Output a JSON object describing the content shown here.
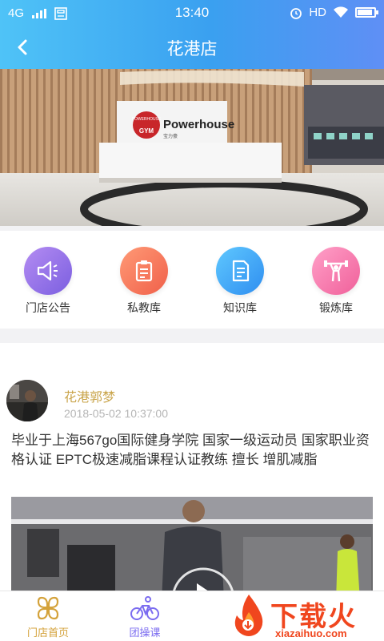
{
  "status_bar": {
    "network": "4G",
    "time": "13:40",
    "hd": "HD"
  },
  "header": {
    "title": "花港店"
  },
  "hero": {
    "sign_brand": "Powerhouse",
    "sign_gym_top": "POWERHOUSE",
    "sign_gym_bottom": "GYM",
    "sign_cn": "宝力豪"
  },
  "menu": {
    "items": [
      {
        "label": "门店公告",
        "icon": "megaphone-icon"
      },
      {
        "label": "私教库",
        "icon": "clipboard-icon"
      },
      {
        "label": "知识库",
        "icon": "document-icon"
      },
      {
        "label": "锻炼库",
        "icon": "weightlifter-icon"
      }
    ]
  },
  "post": {
    "author": "花港郭梦",
    "time": "2018-05-02 10:37:00",
    "text": "毕业于上海567go国际健身学院 国家一级运动员 国家职业资格认证 EPTC极速减脂课程认证教练 擅长  增肌减脂"
  },
  "tabbar": {
    "items": [
      {
        "label": "门店首页",
        "icon": "store-home-icon",
        "active": true
      },
      {
        "label": "团操课",
        "icon": "cycling-icon",
        "active": false
      }
    ]
  },
  "watermark": {
    "text": "下载火",
    "sub": "xiazaihuo.com"
  },
  "colors": {
    "header_start": "#4fc3f7",
    "header_end": "#5f8ff5",
    "author": "#c9a44a",
    "tab_active": "#d4a23a",
    "tab_inactive": "#7b6cf0",
    "watermark": "#f0461e"
  }
}
